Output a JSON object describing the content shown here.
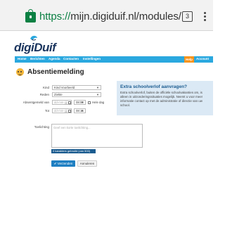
{
  "browser": {
    "url_scheme": "https://",
    "url_rest": "mijn.digiduif.nl/modules/",
    "tab_count": "3"
  },
  "site": {
    "logo_prefix": "digi",
    "logo_suffix": "Duif"
  },
  "nav": {
    "items": [
      "Home",
      "Berichten",
      "Agenda",
      "Contacten",
      "Instellingen"
    ],
    "help": "Help",
    "account": "Account"
  },
  "page": {
    "title": "Absentiemelding"
  },
  "form": {
    "kind_label": "Kind",
    "kind_value": "Kind Voorbeeld",
    "reason_label": "Reden",
    "reason_value": "Ziekte",
    "absent_from_label": "Absentgemeld van",
    "date_placeholder": "dd-mm-jjjj",
    "from_time": "08:00",
    "whole_day_label": "Hele dag",
    "until_label": "Tot",
    "until_time": "08:15",
    "note_label": "Toelichting",
    "note_placeholder": "Geef een korte toelichting...",
    "counter": "0 karakters gebruikt (van 500)",
    "submit_label": "✔ Verzenden",
    "cancel_label": "Annuleren"
  },
  "info": {
    "title": "Extra schoolverlof aanvragen?",
    "body": "Extra schoolverlof, buiten de officiële schoolvakanties om, is alleen in uitzonderingssituaties mogelijk. Neemt u voor meer informatie contact op met de administratie of directie van uw school."
  }
}
